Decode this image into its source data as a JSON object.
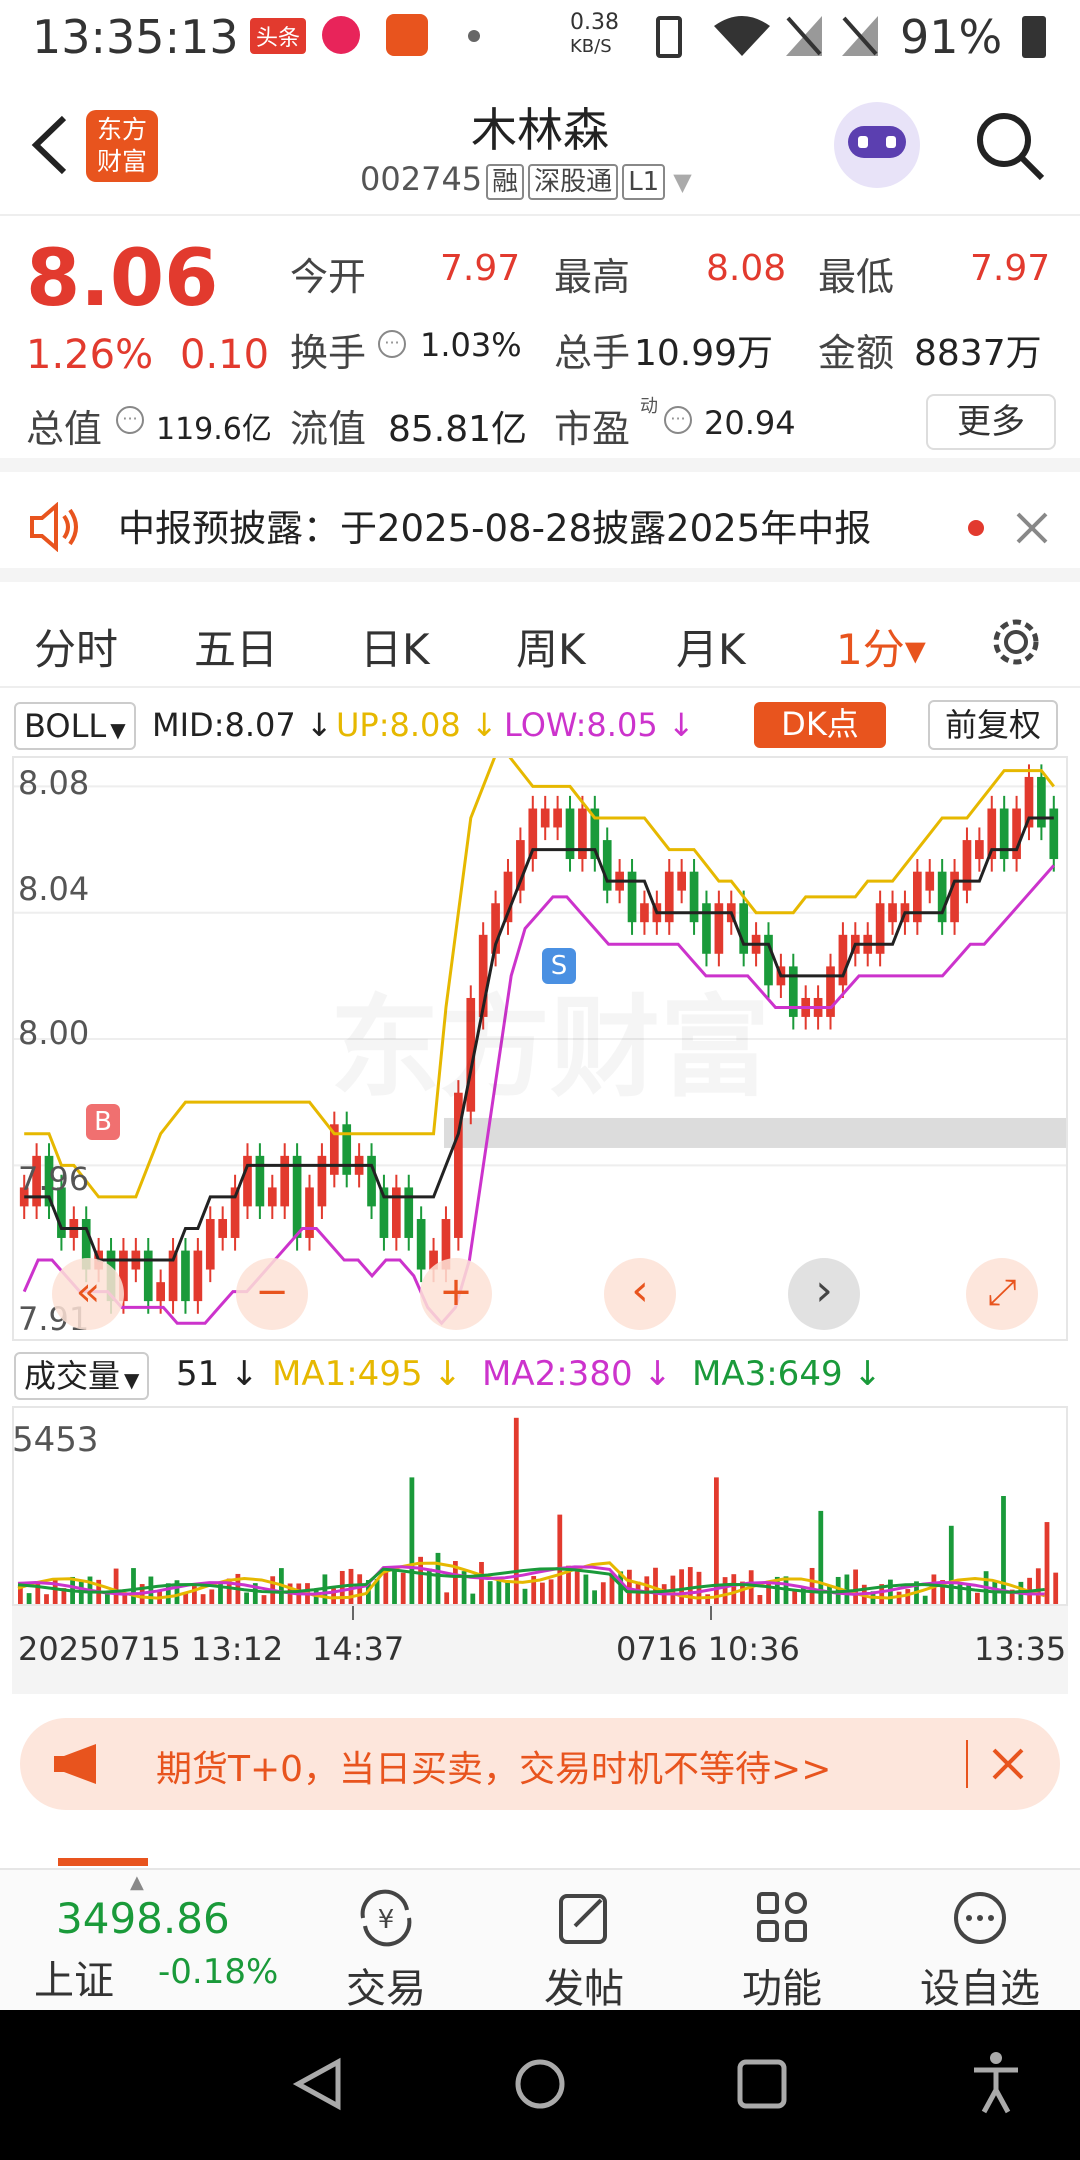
{
  "status_bar": {
    "time": "13:35:13",
    "app_badges": [
      "头条",
      "",
      ""
    ],
    "net_speed_value": "0.38",
    "net_speed_unit": "KB/S",
    "battery": "91%"
  },
  "header": {
    "back_icon": "back-icon",
    "logo_line1": "东方",
    "logo_line2": "财富",
    "stock_name": "木林森",
    "stock_code": "002745",
    "tags": [
      "融",
      "深股通",
      "L1"
    ]
  },
  "quote": {
    "price": "8.06",
    "change_pct": "1.26%",
    "change_amt": "0.10",
    "open_label": "今开",
    "open_value": "7.97",
    "high_label": "最高",
    "high_value": "8.08",
    "low_label": "最低",
    "low_value": "7.97",
    "turnover_label": "换手",
    "turnover_value": "1.03%",
    "volume_label": "总手",
    "volume_value": "10.99万",
    "amount_label": "金额",
    "amount_value": "8837万",
    "mktcap_label": "总值",
    "mktcap_value": "119.6亿",
    "float_label": "流值",
    "float_value": "85.81亿",
    "pe_label": "市盈",
    "pe_sup": "动",
    "pe_value": "20.94",
    "more_label": "更多"
  },
  "notice": {
    "text": "中报预披露：于2025-08-28披露2025年中报"
  },
  "tabs": [
    "分时",
    "五日",
    "日K",
    "周K",
    "月K",
    "1分▾"
  ],
  "indicator": {
    "selector": "BOLL",
    "mid": "MID:8.07",
    "up": "UP:8.08",
    "low": "LOW:8.05",
    "dk_label": "DK点",
    "adjust_label": "前复权"
  },
  "chart_data": {
    "type": "candlestick",
    "y_ticks": [
      "8.08",
      "8.04",
      "8.00",
      "7.96",
      "7.91"
    ],
    "ylim": [
      7.91,
      8.09
    ],
    "close": [
      7.95,
      7.96,
      7.95,
      7.94,
      7.94,
      7.93,
      7.93,
      7.92,
      7.93,
      7.93,
      7.92,
      7.92,
      7.93,
      7.92,
      7.93,
      7.94,
      7.94,
      7.95,
      7.96,
      7.95,
      7.95,
      7.96,
      7.94,
      7.95,
      7.96,
      7.97,
      7.96,
      7.96,
      7.95,
      7.94,
      7.95,
      7.94,
      7.93,
      7.93,
      7.94,
      7.98,
      8.01,
      8.03,
      8.04,
      8.05,
      8.06,
      8.07,
      8.07,
      8.07,
      8.06,
      8.07,
      8.06,
      8.05,
      8.05,
      8.04,
      8.04,
      8.04,
      8.05,
      8.05,
      8.04,
      8.03,
      8.04,
      8.04,
      8.03,
      8.03,
      8.02,
      8.02,
      8.01,
      8.01,
      8.01,
      8.02,
      8.03,
      8.03,
      8.03,
      8.04,
      8.04,
      8.04,
      8.05,
      8.05,
      8.04,
      8.05,
      8.06,
      8.06,
      8.07,
      8.06,
      8.07,
      8.08,
      8.07,
      8.06
    ],
    "mid": [
      7.95,
      7.95,
      7.95,
      7.94,
      7.94,
      7.94,
      7.93,
      7.93,
      7.93,
      7.93,
      7.93,
      7.93,
      7.93,
      7.94,
      7.94,
      7.95,
      7.95,
      7.95,
      7.96,
      7.96,
      7.96,
      7.96,
      7.96,
      7.96,
      7.96,
      7.96,
      7.96,
      7.96,
      7.96,
      7.95,
      7.95,
      7.95,
      7.95,
      7.95,
      7.96,
      7.97,
      7.99,
      8.01,
      8.03,
      8.04,
      8.05,
      8.06,
      8.06,
      8.06,
      8.06,
      8.06,
      8.06,
      8.05,
      8.05,
      8.05,
      8.05,
      8.04,
      8.04,
      8.04,
      8.04,
      8.04,
      8.04,
      8.04,
      8.03,
      8.03,
      8.03,
      8.02,
      8.02,
      8.02,
      8.02,
      8.02,
      8.02,
      8.03,
      8.03,
      8.03,
      8.03,
      8.04,
      8.04,
      8.04,
      8.04,
      8.05,
      8.05,
      8.05,
      8.06,
      8.06,
      8.06,
      8.07,
      8.07,
      8.07
    ],
    "up": [
      7.97,
      7.97,
      7.97,
      7.96,
      7.96,
      7.955,
      7.95,
      7.95,
      7.95,
      7.95,
      7.96,
      7.97,
      7.975,
      7.98,
      7.98,
      7.98,
      7.98,
      7.98,
      7.98,
      7.98,
      7.98,
      7.98,
      7.98,
      7.98,
      7.975,
      7.97,
      7.97,
      7.97,
      7.97,
      7.97,
      7.97,
      7.97,
      7.97,
      7.97,
      8.01,
      8.04,
      8.07,
      8.08,
      8.09,
      8.09,
      8.085,
      8.08,
      8.08,
      8.08,
      8.08,
      8.075,
      8.07,
      8.07,
      8.07,
      8.07,
      8.07,
      8.065,
      8.06,
      8.06,
      8.06,
      8.055,
      8.05,
      8.05,
      8.045,
      8.04,
      8.04,
      8.04,
      8.04,
      8.045,
      8.045,
      8.045,
      8.045,
      8.045,
      8.05,
      8.05,
      8.05,
      8.055,
      8.06,
      8.065,
      8.07,
      8.07,
      8.07,
      8.075,
      8.08,
      8.085,
      8.085,
      8.085,
      8.085,
      8.08
    ],
    "low": [
      7.92,
      7.93,
      7.93,
      7.925,
      7.92,
      7.92,
      7.92,
      7.915,
      7.915,
      7.915,
      7.915,
      7.91,
      7.91,
      7.91,
      7.915,
      7.92,
      7.92,
      7.925,
      7.93,
      7.935,
      7.94,
      7.94,
      7.935,
      7.93,
      7.93,
      7.925,
      7.93,
      7.93,
      7.925,
      7.915,
      7.91,
      7.915,
      7.93,
      7.96,
      7.99,
      8.02,
      8.035,
      8.04,
      8.045,
      8.045,
      8.04,
      8.035,
      8.03,
      8.03,
      8.03,
      8.03,
      8.03,
      8.03,
      8.025,
      8.02,
      8.02,
      8.02,
      8.02,
      8.015,
      8.01,
      8.01,
      8.01,
      8.01,
      8.01,
      8.015,
      8.02,
      8.02,
      8.02,
      8.02,
      8.02,
      8.02,
      8.02,
      8.025,
      8.03,
      8.03,
      8.035,
      8.04,
      8.045,
      8.05,
      8.055
    ]
  },
  "chart_controls": [
    "«",
    "−",
    "+",
    "‹",
    "›",
    "⤢"
  ],
  "signals": {
    "buy": "B",
    "sell": "S"
  },
  "watermark": "东方财富",
  "volume": {
    "selector": "成交量",
    "value": "51",
    "ma1": "MA1:495",
    "ma2": "MA2:380",
    "ma3": "MA3:649",
    "max_label": "5453"
  },
  "x_axis": {
    "d1": "20250715 13:12",
    "d2": "14:37",
    "d3": "0716 10:36",
    "d4": "13:35"
  },
  "promo": {
    "text": "期货T+0，当日买卖，交易时机不等待>>"
  },
  "bottom_bar": {
    "index_value": "3498.86",
    "index_name": "上证",
    "index_change": "-0.18%",
    "items": [
      "交易",
      "发帖",
      "功能",
      "设自选"
    ]
  },
  "colors": {
    "up": "#e23a2e",
    "down": "#1a9a3a",
    "boll_mid": "#222222",
    "boll_up": "#e6b800",
    "boll_low": "#cc33cc",
    "accent": "#e8541e"
  }
}
